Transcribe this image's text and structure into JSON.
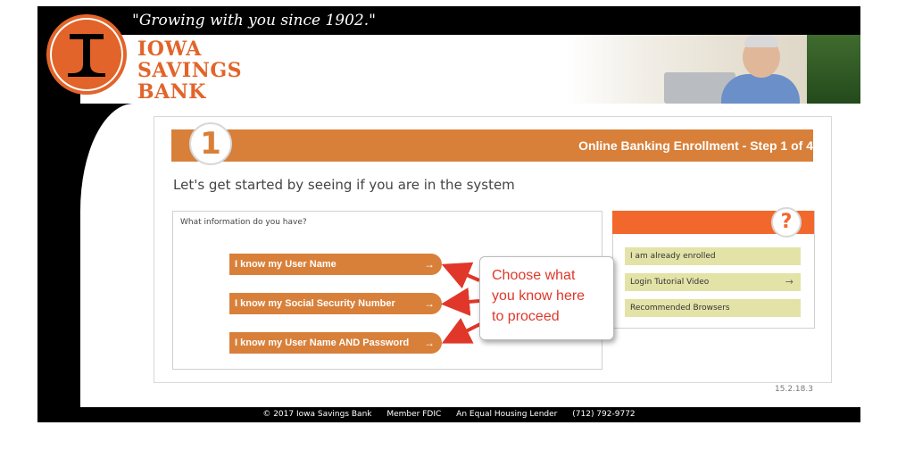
{
  "header": {
    "tagline": "\"Growing with you since 1902.\"",
    "bank_name_line1": "IOWA",
    "bank_name_line2": "SAVINGS",
    "bank_name_line3": "BANK"
  },
  "step": {
    "number": "1",
    "title": "Online Banking Enrollment - Step 1 of 4",
    "subheading": "Let's get started by seeing if you are in the system"
  },
  "info": {
    "label": "What information do you have?",
    "options": [
      {
        "label": "I know my User Name",
        "arrow": "→"
      },
      {
        "label": "I know my Social Security Number",
        "arrow": "→"
      },
      {
        "label": "I know my User Name AND Password",
        "arrow": "→"
      }
    ]
  },
  "help": {
    "icon": "?",
    "links": [
      {
        "label": "I am already enrolled",
        "arrow": ""
      },
      {
        "label": "Login Tutorial Video",
        "arrow": "→"
      },
      {
        "label": "Recommended Browsers",
        "arrow": ""
      }
    ]
  },
  "callout": {
    "line1": "Choose what",
    "line2": "you know here",
    "line3": "to proceed"
  },
  "version": "15.2.18.3",
  "footer": {
    "copyright": "© 2017 Iowa Savings Bank",
    "fdic": "Member FDIC",
    "housing": "An Equal Housing Lender",
    "phone": "(712) 792-9772"
  },
  "colors": {
    "brand_orange": "#d8803a",
    "accent_orange": "#f2682c",
    "callout_red": "#e0372a",
    "help_link_bg": "#e3e3a8"
  }
}
